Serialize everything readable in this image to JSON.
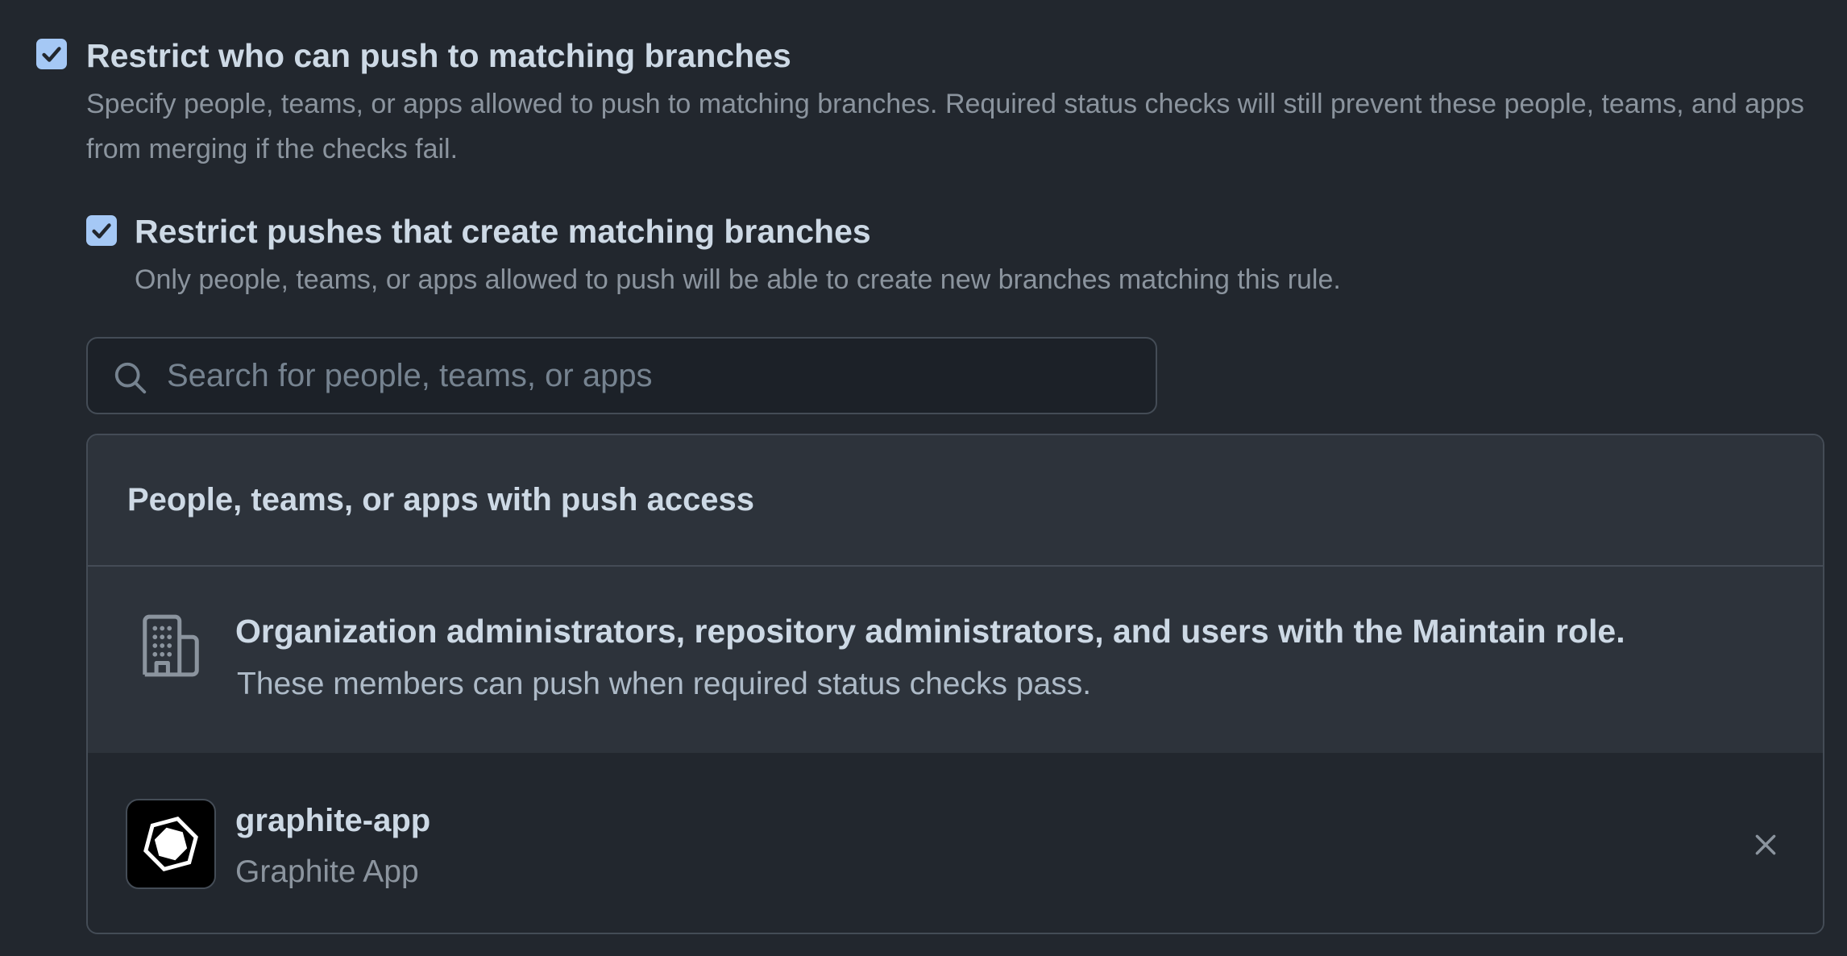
{
  "restrict_push": {
    "checked": true,
    "title": "Restrict who can push to matching branches",
    "description": "Specify people, teams, or apps allowed to push to matching branches. Required status checks will still prevent these people, teams, and apps from merging if the checks fail."
  },
  "restrict_create": {
    "checked": true,
    "title": "Restrict pushes that create matching branches",
    "description": "Only people, teams, or apps allowed to push will be able to create new branches matching this rule."
  },
  "search": {
    "placeholder": "Search for people, teams, or apps",
    "value": ""
  },
  "access_panel": {
    "title": "People, teams, or apps with push access",
    "org_entry": {
      "icon": "organization-icon",
      "title": "Organization administrators, repository administrators, and users with the Maintain role.",
      "description": "These members can push when required status checks pass."
    },
    "apps": [
      {
        "icon": "graphite-logo-icon",
        "slug": "graphite-app",
        "name": "Graphite App"
      }
    ]
  },
  "colors": {
    "background": "#22272e",
    "panel_header": "#2d333b",
    "border": "#444c56",
    "checkbox": "#a5c8f5",
    "text_primary": "#cdd9e5",
    "text_muted": "#8b949e"
  }
}
